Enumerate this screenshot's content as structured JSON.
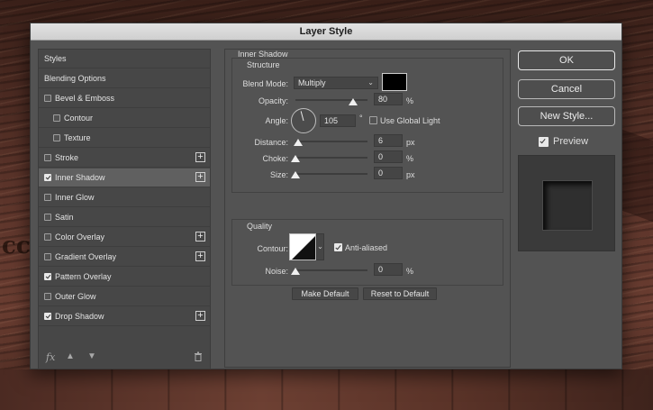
{
  "background": {
    "letters": "cc"
  },
  "dialog": {
    "title": "Layer Style",
    "styles_list": [
      {
        "label": "Styles",
        "checkbox": null,
        "plus": false,
        "selected": false,
        "indent": 0
      },
      {
        "label": "Blending Options",
        "checkbox": null,
        "plus": false,
        "selected": false,
        "indent": 0
      },
      {
        "label": "Bevel & Emboss",
        "checkbox": false,
        "plus": false,
        "selected": false,
        "indent": 0
      },
      {
        "label": "Contour",
        "checkbox": false,
        "plus": false,
        "selected": false,
        "indent": 1
      },
      {
        "label": "Texture",
        "checkbox": false,
        "plus": false,
        "selected": false,
        "indent": 1
      },
      {
        "label": "Stroke",
        "checkbox": false,
        "plus": true,
        "selected": false,
        "indent": 0
      },
      {
        "label": "Inner Shadow",
        "checkbox": true,
        "plus": true,
        "selected": true,
        "indent": 0
      },
      {
        "label": "Inner Glow",
        "checkbox": false,
        "plus": false,
        "selected": false,
        "indent": 0
      },
      {
        "label": "Satin",
        "checkbox": false,
        "plus": false,
        "selected": false,
        "indent": 0
      },
      {
        "label": "Color Overlay",
        "checkbox": false,
        "plus": true,
        "selected": false,
        "indent": 0
      },
      {
        "label": "Gradient Overlay",
        "checkbox": false,
        "plus": true,
        "selected": false,
        "indent": 0
      },
      {
        "label": "Pattern Overlay",
        "checkbox": true,
        "plus": false,
        "selected": false,
        "indent": 0
      },
      {
        "label": "Outer Glow",
        "checkbox": false,
        "plus": false,
        "selected": false,
        "indent": 0
      },
      {
        "label": "Drop Shadow",
        "checkbox": true,
        "plus": true,
        "selected": false,
        "indent": 0
      }
    ],
    "footer_icons": {
      "fx": "fx",
      "up": "arrow-up-icon",
      "down": "arrow-down-icon",
      "trash": "trash-icon"
    },
    "inner_shadow": {
      "heading": "Inner Shadow",
      "structure_heading": "Structure",
      "blend_mode_label": "Blend Mode:",
      "blend_mode_value": "Multiply",
      "blend_color": "#000000",
      "opacity_label": "Opacity:",
      "opacity_value": "80",
      "opacity_level": 0.8,
      "opacity_unit": "%",
      "angle_label": "Angle:",
      "angle_value": "105",
      "angle_unit": "°",
      "use_global_light_label": "Use Global Light",
      "use_global_light": false,
      "distance_label": "Distance:",
      "distance_value": "6",
      "distance_unit": "px",
      "choke_label": "Choke:",
      "choke_value": "0",
      "choke_unit": "%",
      "size_label": "Size:",
      "size_value": "0",
      "size_unit": "px",
      "quality_heading": "Quality",
      "contour_label": "Contour:",
      "anti_aliased_label": "Anti-aliased",
      "anti_aliased": true,
      "noise_label": "Noise:",
      "noise_value": "0",
      "noise_unit": "%",
      "make_default_label": "Make Default",
      "reset_default_label": "Reset to Default"
    },
    "buttons": {
      "ok": "OK",
      "cancel": "Cancel",
      "new_style": "New Style...",
      "preview_label": "Preview",
      "preview_checked": true
    }
  }
}
